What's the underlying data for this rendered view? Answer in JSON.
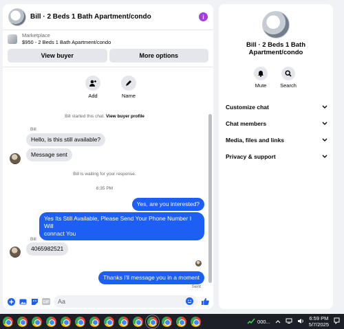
{
  "header": {
    "title": "Bill · 2 Beds 1 Bath Apartment/condo",
    "info_icon": "info-icon"
  },
  "listing": {
    "category": "Marketplace",
    "name": "$950 - 2 Beds 1 Bath Apartment/condo"
  },
  "buttons": {
    "view_buyer": "View buyer",
    "more_options": "More options"
  },
  "quick_actions": {
    "add": "Add",
    "name": "Name"
  },
  "conversation": {
    "started_prefix": "Bill started this chat.",
    "started_link": "View buyer profile",
    "sender_1": "Bill",
    "msg_1": "Hello, is this still available?",
    "msg_2": "Message sent",
    "waiting": "Bill is waiting for your response.",
    "time": "6:35 PM",
    "out_1": "Yes, are you interested?",
    "out_2_line1": "Yes Its Still Available, Please Send Your Phone Number I Will",
    "out_2_line2": "connact You",
    "sender_2": "Bill",
    "msg_3": "4065982521",
    "out_3": "Thanks I'll message you in a moment",
    "sent": "Sent"
  },
  "composer": {
    "placeholder": "Aa"
  },
  "details": {
    "title_line1": "Bill · 2 Beds 1 Bath",
    "title_line2": "Apartment/condo",
    "mute": "Mute",
    "search": "Search",
    "sections": [
      "Customize chat",
      "Chat members",
      "Media, files and links",
      "Privacy & support"
    ]
  },
  "taskbar": {
    "stock": "000...",
    "time": "6:59 PM",
    "date": "5/7/2025"
  },
  "colors": {
    "accent": "#1d5ef5",
    "info": "#a33fd6"
  }
}
